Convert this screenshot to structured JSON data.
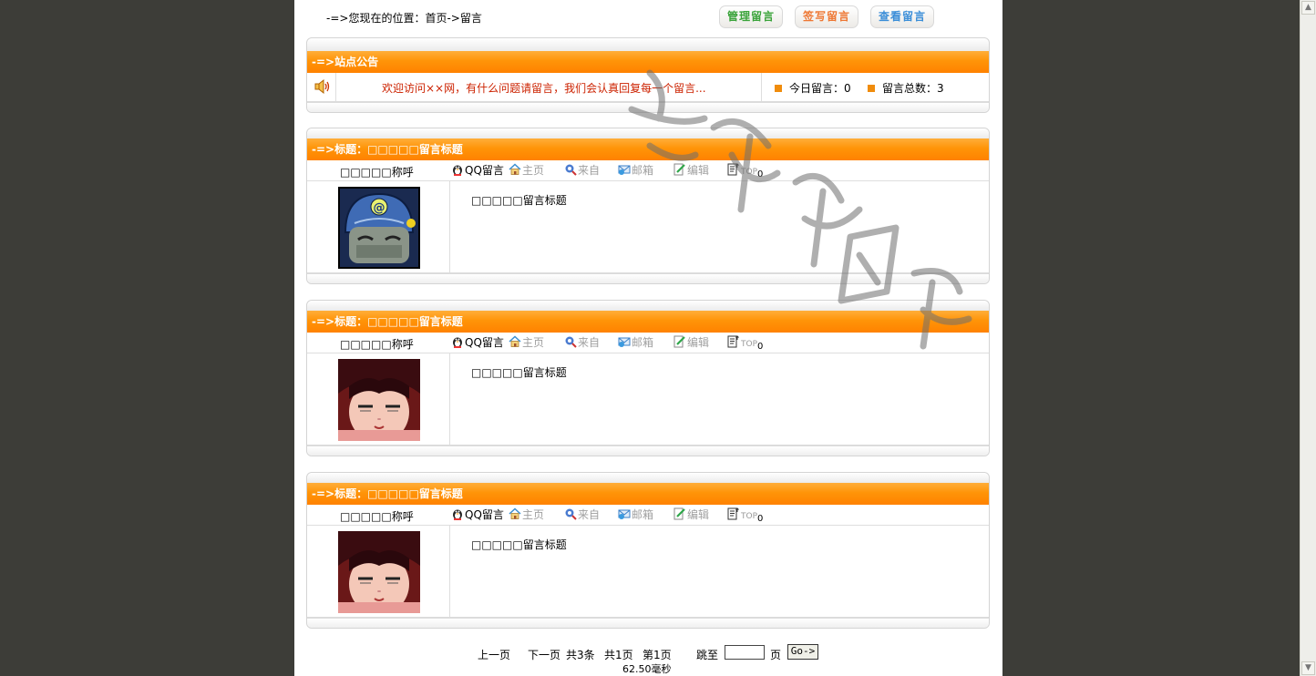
{
  "header": {
    "location": "-=>您现在的位置：首页->留言",
    "buttons": {
      "manage": "管理留言",
      "write": "签写留言",
      "view": "查看留言"
    }
  },
  "notice": {
    "bar_title": "-=>站点公告",
    "speaker_icon": "speaker-icon",
    "text": "欢迎访问××网，有什么问题请留言，我们会认真回复每一个留言...",
    "today_label": "今日留言：0",
    "total_label": "留言总数：3"
  },
  "messages": [
    {
      "title": "-=>标题：□□□□□留言标题",
      "name": "□□□□□称呼",
      "actions": {
        "qq": "QQ留言",
        "home": "主页",
        "from": "来自",
        "email": "邮箱",
        "edit": "编辑",
        "top": "TOP",
        "top_count": "0"
      },
      "body": "□□□□□留言标题",
      "avatar": "helmet-avatar"
    },
    {
      "title": "-=>标题：□□□□□留言标题",
      "name": "□□□□□称呼",
      "actions": {
        "qq": "QQ留言",
        "home": "主页",
        "from": "来自",
        "email": "邮箱",
        "edit": "编辑",
        "top": "TOP",
        "top_count": "0"
      },
      "body": "□□□□□留言标题",
      "avatar": "anime-face-avatar"
    },
    {
      "title": "-=>标题：□□□□□留言标题",
      "name": "□□□□□称呼",
      "actions": {
        "qq": "QQ留言",
        "home": "主页",
        "from": "来自",
        "email": "邮箱",
        "edit": "编辑",
        "top": "TOP",
        "top_count": "0"
      },
      "body": "□□□□□留言标题",
      "avatar": "anime-face-avatar"
    }
  ],
  "pager": {
    "prev": "上一页",
    "next": "下一页",
    "total_items": "共3条",
    "total_pages": "共1页",
    "current": "第1页",
    "jump_to": "跳至",
    "page_unit": "页",
    "go": "Go->",
    "timing": "62.50毫秒"
  },
  "colors": {
    "orange": "#ff9408",
    "notice_red": "#cc2200",
    "background": "#3d3d38"
  }
}
